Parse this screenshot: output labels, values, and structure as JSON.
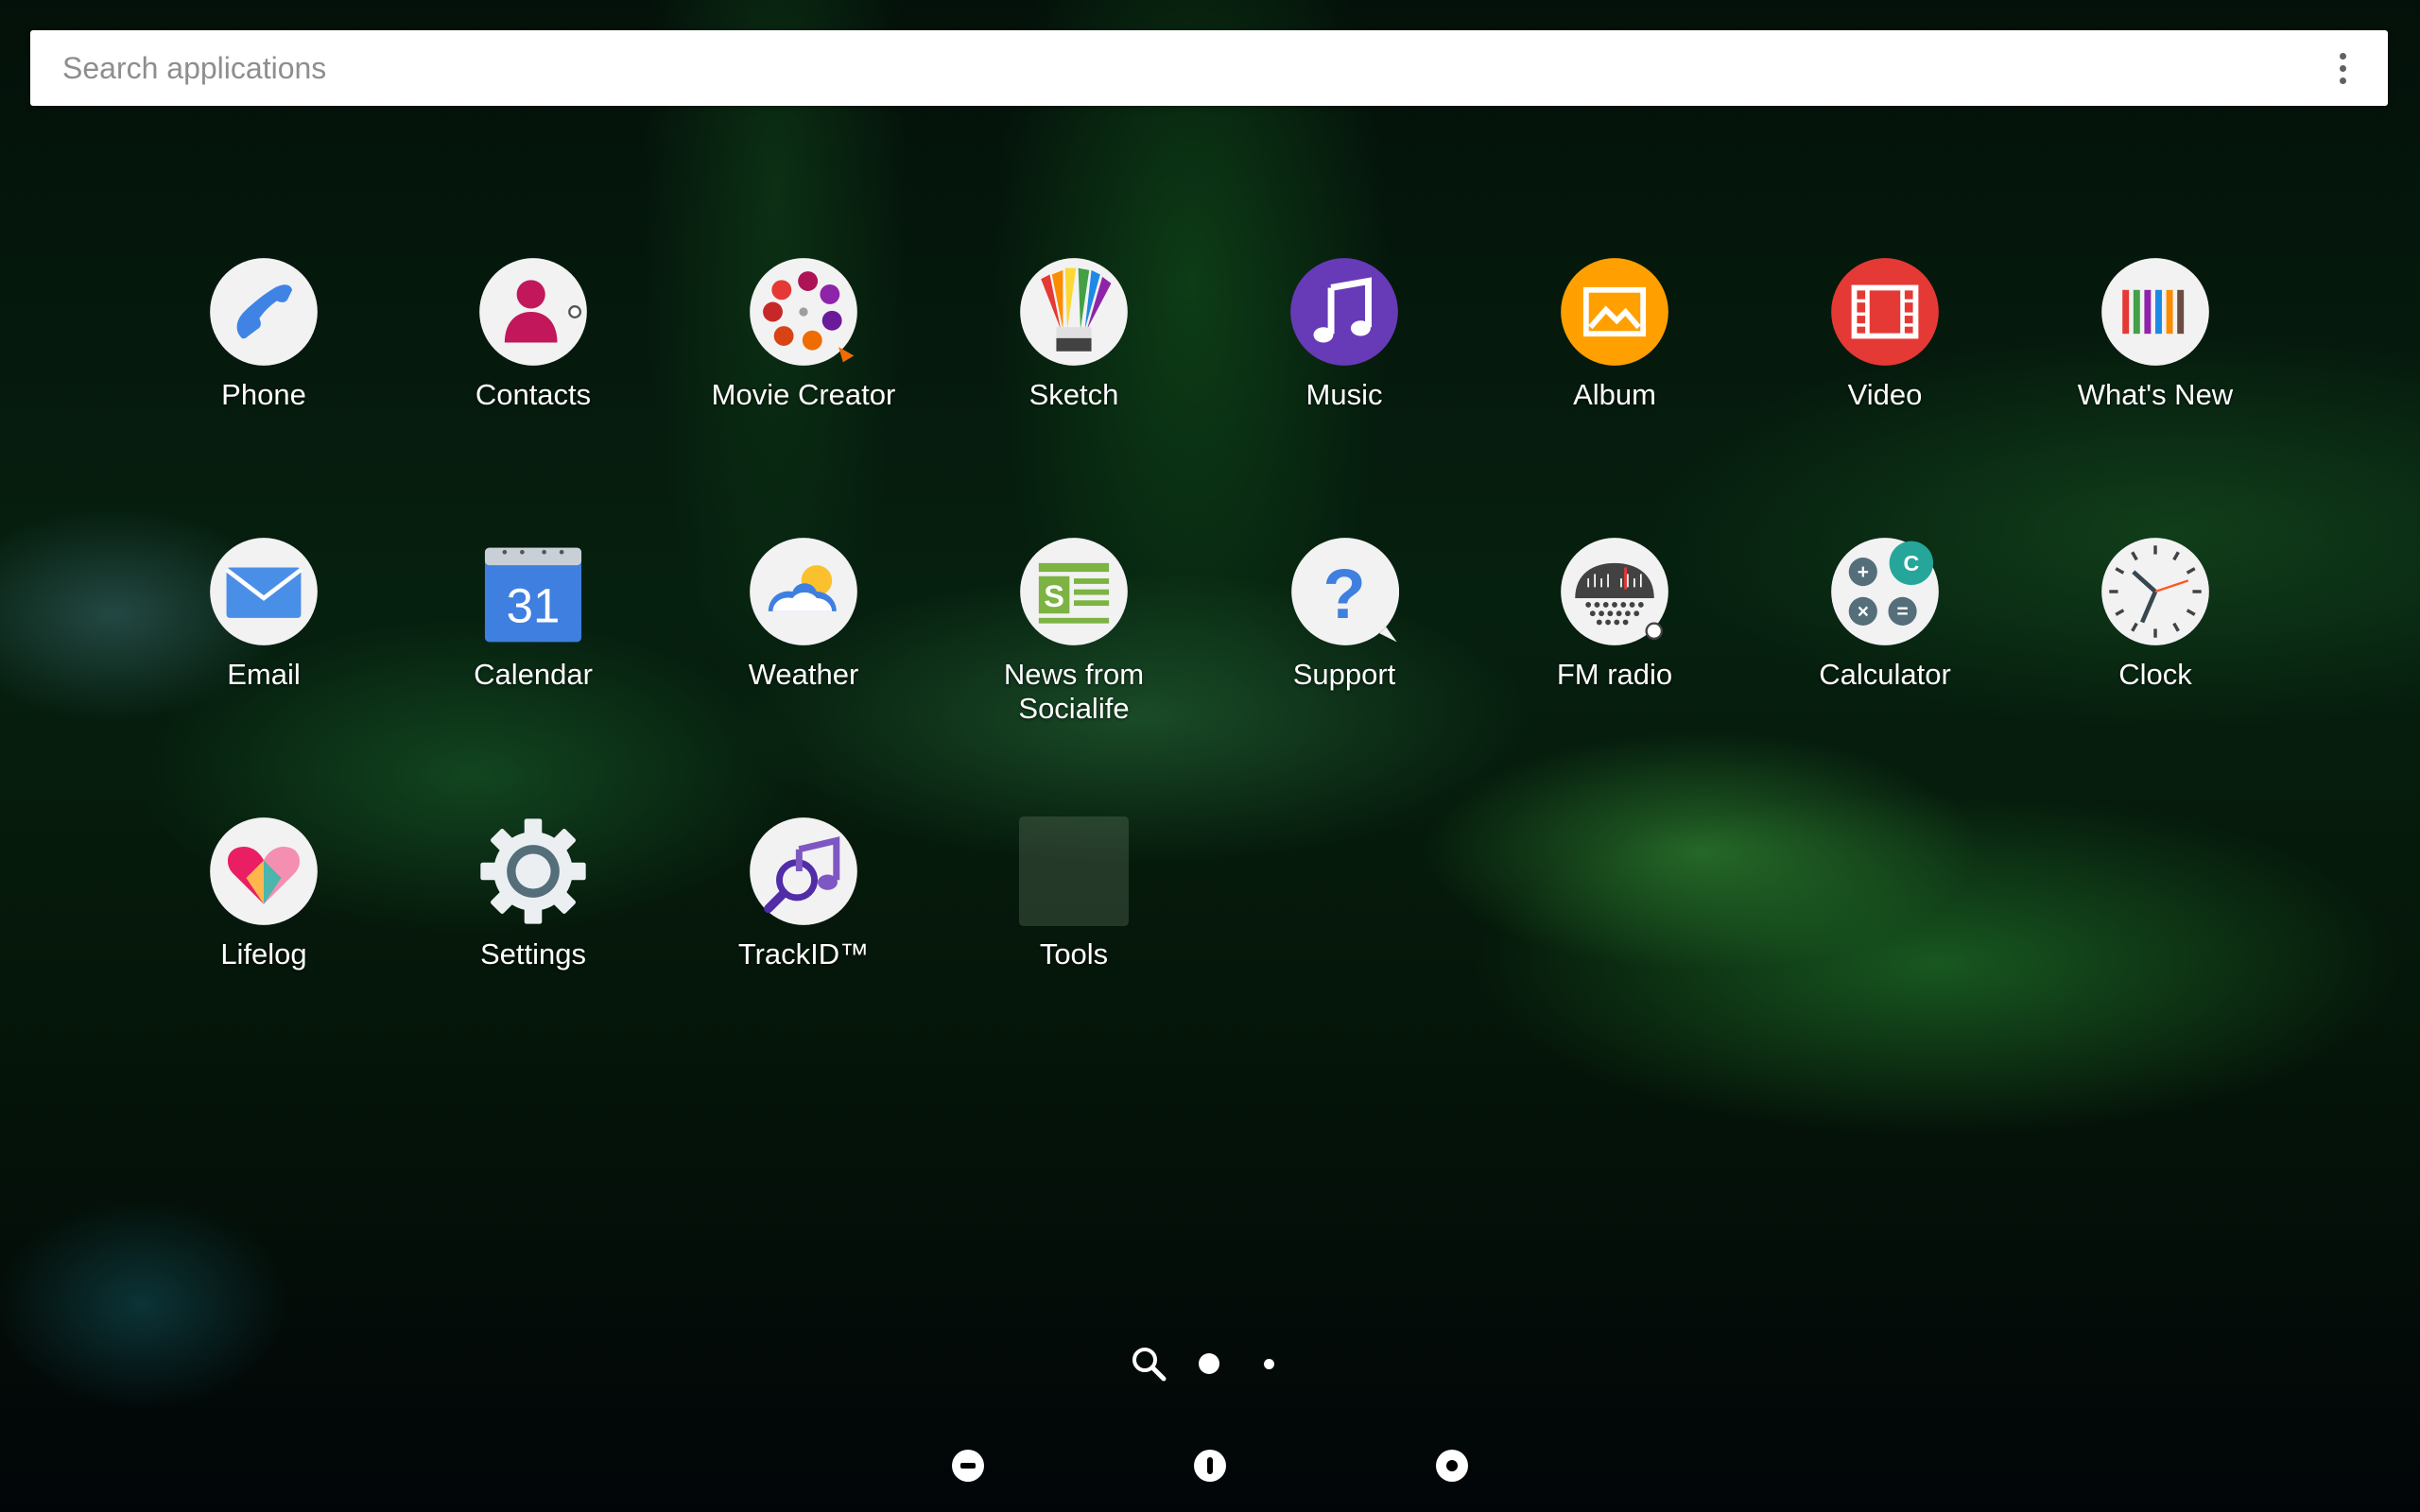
{
  "search": {
    "placeholder": "Search applications",
    "menu_icon": "overflow-menu-icon"
  },
  "apps": [
    {
      "label": "Phone",
      "icon": "phone-icon"
    },
    {
      "label": "Contacts",
      "icon": "contacts-icon"
    },
    {
      "label": "Movie Creator",
      "icon": "movie-creator-icon"
    },
    {
      "label": "Sketch",
      "icon": "sketch-icon"
    },
    {
      "label": "Music",
      "icon": "music-icon"
    },
    {
      "label": "Album",
      "icon": "album-icon"
    },
    {
      "label": "Video",
      "icon": "video-icon"
    },
    {
      "label": "What's New",
      "icon": "whats-new-icon"
    },
    {
      "label": "Email",
      "icon": "email-icon"
    },
    {
      "label": "Calendar",
      "icon": "calendar-icon",
      "badge": "31"
    },
    {
      "label": "Weather",
      "icon": "weather-icon"
    },
    {
      "label": "News from\nSocialife",
      "icon": "socialife-icon"
    },
    {
      "label": "Support",
      "icon": "support-icon"
    },
    {
      "label": "FM radio",
      "icon": "fm-radio-icon"
    },
    {
      "label": "Calculator",
      "icon": "calculator-icon"
    },
    {
      "label": "Clock",
      "icon": "clock-icon"
    },
    {
      "label": "Lifelog",
      "icon": "lifelog-icon"
    },
    {
      "label": "Settings",
      "icon": "settings-gear-icon"
    },
    {
      "label": "TrackID™",
      "icon": "trackid-icon"
    },
    {
      "label": "Tools",
      "icon": "tools-folder-icon"
    }
  ],
  "page_indicator": {
    "search_icon": "search-icon",
    "pages": 2,
    "current": 1
  },
  "nav_bar": {
    "back": "back-icon",
    "home": "home-icon",
    "recent": "recent-apps-icon"
  }
}
